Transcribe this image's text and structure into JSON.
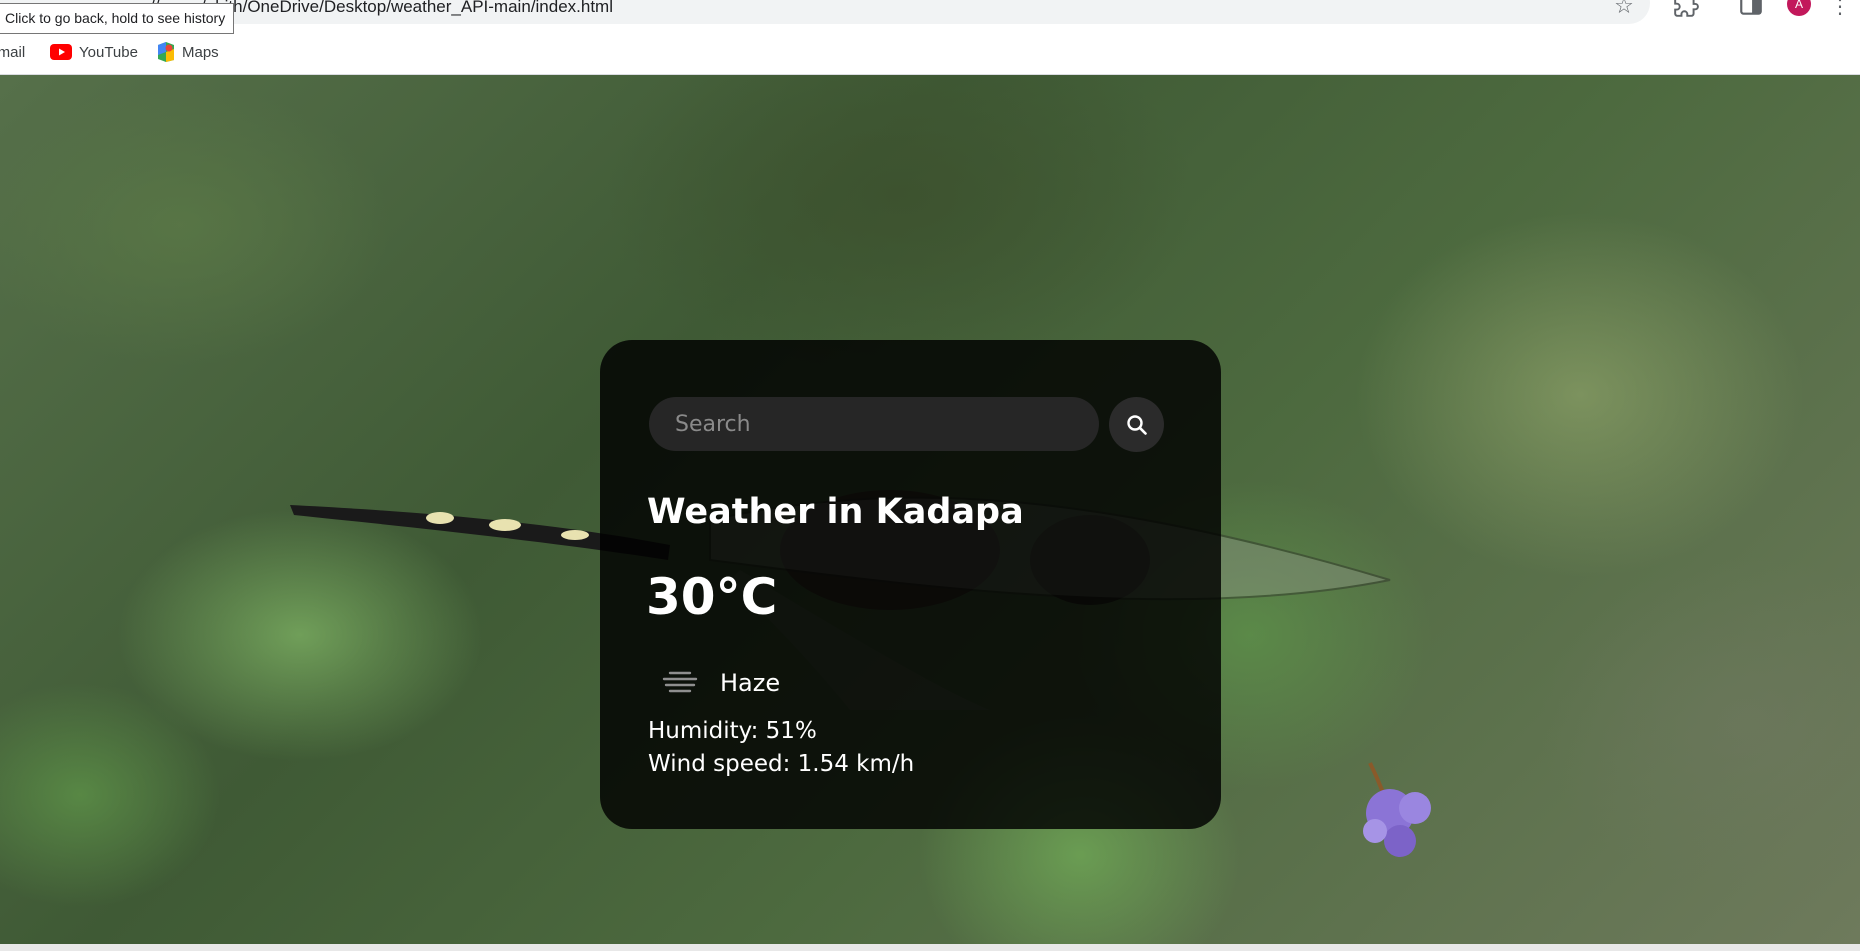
{
  "browser": {
    "url": "//users/abith/OneDrive/Desktop/weather_API-main/index.html",
    "tooltip": "Click to go back, hold to see history",
    "profile_initial": "A",
    "bookmarks": [
      {
        "label": "Gmail",
        "icon": "gmail-icon"
      },
      {
        "label": "YouTube",
        "icon": "youtube-icon"
      },
      {
        "label": "Maps",
        "icon": "maps-icon"
      }
    ]
  },
  "weather": {
    "search_placeholder": "Search",
    "search_value": "",
    "city_heading": "Weather in Kadapa",
    "temperature": "30°C",
    "description": "Haze",
    "condition_icon": "haze-icon",
    "humidity": "Humidity: 51%",
    "wind": "Wind speed: 1.54 km/h"
  },
  "colors": {
    "card_background": "#000000",
    "text": "#ffffff",
    "search_background": "#262626",
    "avatar": "#c2185b"
  }
}
